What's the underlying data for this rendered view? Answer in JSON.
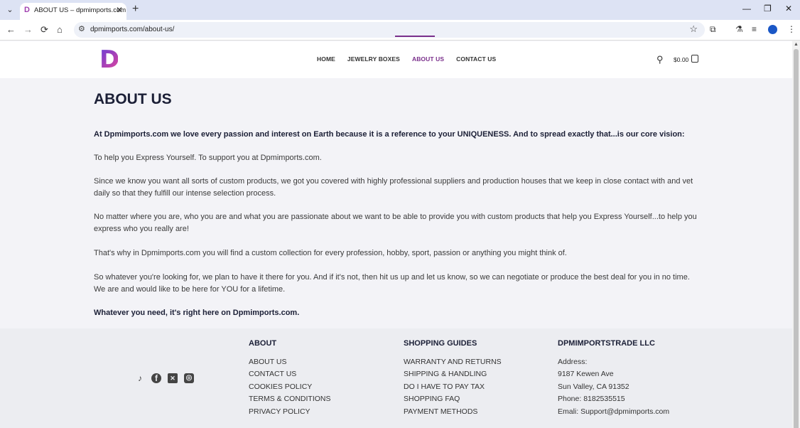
{
  "browser": {
    "tab_title": "ABOUT US – dpmimports.com",
    "tab_favicon": "D",
    "url": "dpmimports.com/about-us/"
  },
  "icons": {
    "back": "←",
    "forward": "→",
    "reload": "⟳",
    "home": "⌂",
    "site_info": "⚙",
    "star": "☆",
    "extensions": "⧉",
    "labs": "⚗",
    "media": "≡",
    "menu": "⋮",
    "minimize": "—",
    "restore": "❐",
    "close": "✕",
    "tab_close": "✕",
    "new_tab": "+",
    "tab_list": "⌄",
    "search": "⚲",
    "tiktok": "♪",
    "facebook": "f",
    "x": "✕",
    "instagram": "◎"
  },
  "header": {
    "logo": "D",
    "nav": [
      "HOME",
      "JEWELRY BOXES",
      "ABOUT US",
      "CONTACT US"
    ],
    "active_nav": "ABOUT US",
    "cart_total": "$0.00"
  },
  "content": {
    "title": "ABOUT US",
    "paragraphs": [
      "At Dpmimports.com we love every passion and interest on Earth because it is a reference to your UNIQUENESS. And to spread exactly that...is our core vision:",
      "To help you Express Yourself. To support you at Dpmimports.com.",
      "Since we know you want all sorts of custom products, we got you covered with highly professional suppliers and production houses that we keep in close contact with and vet daily so that they fulfill our intense selection process.",
      "No matter where you are, who you are and what you are passionate about we want to be able to provide you with custom products that help you Express Yourself...to help you express who you really are!",
      "That's why in Dpmimports.com you will find a custom collection for every profession, hobby, sport, passion or anything you might think of.",
      "So whatever you're looking for, we plan to have it there for you. And if it's not, then hit us up and let us know, so we can negotiate or produce the best deal for you in no time. We are and would like to be here for YOU for a lifetime.",
      "Whatever you need, it's right here on Dpmimports.com."
    ]
  },
  "footer": {
    "about": {
      "title": "ABOUT",
      "items": [
        "ABOUT US",
        "CONTACT US",
        "COOKIES POLICY",
        "TERMS & CONDITIONS",
        "PRIVACY POLICY"
      ]
    },
    "guides": {
      "title": "SHOPPING GUIDES",
      "items": [
        "WARRANTY AND RETURNS",
        "SHIPPING & HANDLING",
        "DO I HAVE TO PAY TAX",
        "SHOPPING FAQ",
        "PAYMENT METHODS"
      ]
    },
    "company": {
      "title": "DPMIMPORTSTRADE LLC",
      "items": [
        "Address:",
        "9187 Kewen Ave",
        "Sun Valley, CA 91352",
        "Phone: 8182535515",
        "Emali: Support@dpmimports.com"
      ]
    }
  },
  "colors": {
    "accent": "#7a2f8b",
    "heading": "#1b1f36",
    "footer_bg": "#ecedf1"
  }
}
